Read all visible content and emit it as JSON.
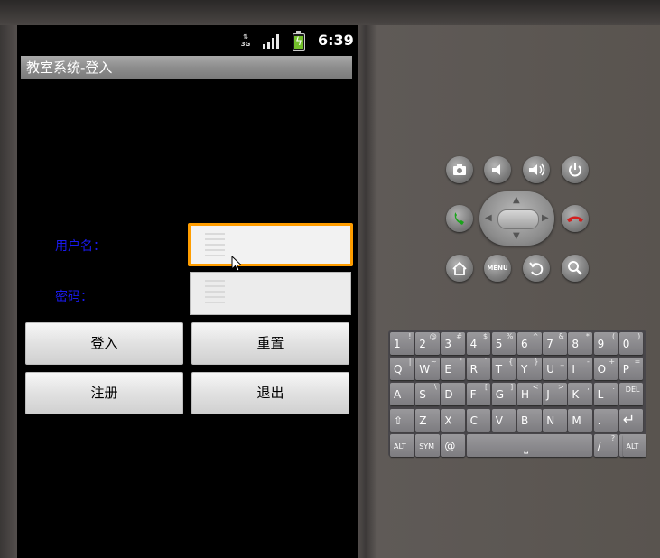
{
  "status_bar": {
    "network": "3G",
    "time": "6:39"
  },
  "app": {
    "title": "教室系统-登入"
  },
  "form": {
    "username_label": "用户名：",
    "password_label": "密码："
  },
  "buttons": {
    "login": "登入",
    "reset": "重置",
    "register": "注册",
    "exit": "退出"
  },
  "controls": {
    "menu_label": "MENU"
  },
  "keyboard": {
    "rows": [
      [
        [
          "1",
          "!"
        ],
        [
          "2",
          "@"
        ],
        [
          "3",
          "#"
        ],
        [
          "4",
          "$"
        ],
        [
          "5",
          "%"
        ],
        [
          "6",
          "^"
        ],
        [
          "7",
          "&"
        ],
        [
          "8",
          "*"
        ],
        [
          "9",
          "("
        ],
        [
          "0",
          ")"
        ]
      ],
      [
        [
          "Q",
          "|"
        ],
        [
          "W",
          "~"
        ],
        [
          "E",
          "\""
        ],
        [
          "R",
          "`"
        ],
        [
          "T",
          "{"
        ],
        [
          "Y",
          "}"
        ],
        [
          "U",
          "_"
        ],
        [
          "I",
          "-"
        ],
        [
          "O",
          "+"
        ],
        [
          "P",
          "="
        ]
      ],
      [
        [
          "A",
          ""
        ],
        [
          "S",
          "\\"
        ],
        [
          "D",
          ""
        ],
        [
          "F",
          "["
        ],
        [
          "G",
          "]"
        ],
        [
          "H",
          "<"
        ],
        [
          "J",
          ">"
        ],
        [
          "K",
          ";"
        ],
        [
          "L",
          ":"
        ],
        [
          "DEL",
          ""
        ]
      ],
      [
        [
          "⇧",
          ""
        ],
        [
          "Z",
          ""
        ],
        [
          "X",
          ""
        ],
        [
          "C",
          ""
        ],
        [
          "V",
          ""
        ],
        [
          "B",
          ""
        ],
        [
          "N",
          ""
        ],
        [
          "M",
          ""
        ],
        [
          ".",
          ""
        ],
        [
          "↵",
          ""
        ]
      ]
    ],
    "bottom": {
      "alt_left": "ALT",
      "sym": "SYM",
      "at": "@",
      "slash": "/",
      "question": "?",
      "comma": ",",
      "alt_right": "ALT"
    }
  }
}
